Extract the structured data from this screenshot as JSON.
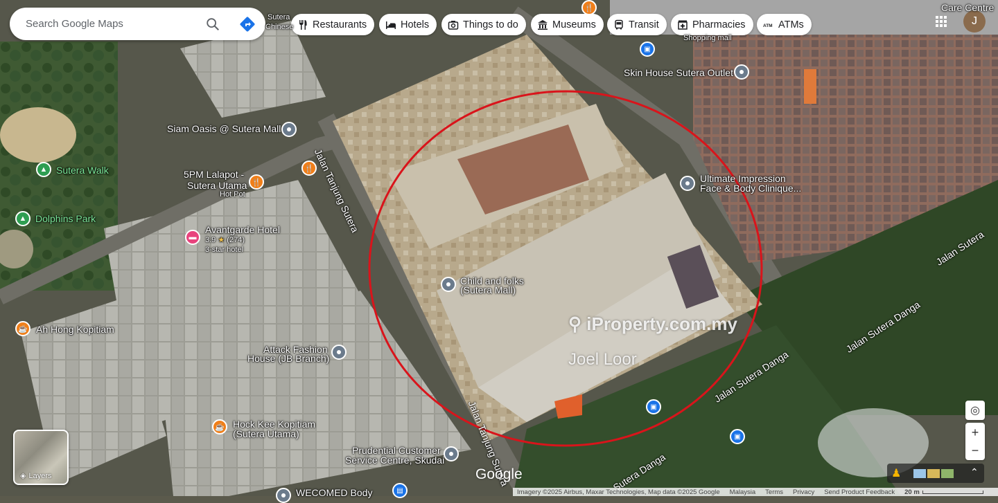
{
  "search": {
    "placeholder": "Search Google Maps"
  },
  "chips": [
    {
      "label": "Restaurants",
      "icon": "fork-knife-icon"
    },
    {
      "label": "Hotels",
      "icon": "bed-icon"
    },
    {
      "label": "Things to do",
      "icon": "camera-icon"
    },
    {
      "label": "Museums",
      "icon": "museum-icon"
    },
    {
      "label": "Transit",
      "icon": "bus-icon"
    },
    {
      "label": "Pharmacies",
      "icon": "pharmacy-icon"
    },
    {
      "label": "ATMs",
      "icon": "atm-icon"
    }
  ],
  "places": {
    "siam_oasis": "Siam Oasis @ Sutera Mall",
    "sutera_walk": "Sutera Walk",
    "lalapot_1": "5PM Lalapot -",
    "lalapot_2": "Sutera Utama",
    "lalapot_3": "Hot Pot",
    "dolphins_park": "Dolphins Park",
    "avantgarde": "Avantgarde Hotel",
    "avantgarde_rating": "3.9",
    "avantgarde_reviews": "(274)",
    "avantgarde_type": "3-star hotel",
    "ah_hong": "Ah Hong Kopitiam",
    "attack_1": "Attack Fashion",
    "attack_2": "House (JB Branch)",
    "hock_kee_1": "Hock Kee Kopitiam",
    "hock_kee_2": "(Sutera Utama)",
    "prudential_1": "Prudential Customer",
    "prudential_2": "Service Centre, Skudai",
    "wecomed": "WECOMED Body",
    "child_folks_1": "Child and folks",
    "child_folks_2": "(Sutera Mall)",
    "skin_house": "Skin House Sutera Outlet",
    "ultimate_1": "Ultimate Impression",
    "ultimate_2": "Face & Body Clinique...",
    "shopping_mall": "Shopping mall",
    "sutera_chinese_1": "Sutera",
    "sutera_chinese_2": "Chinese",
    "care_centre": "Care Centre"
  },
  "roads": {
    "tanjung_1": "Jalan Tanjung Sutera",
    "tanjung_2": "Jalan Tanjung Sutera",
    "danga_1": "Jalan Sutera Danga",
    "danga_2": "Jalan Sutera Danga",
    "danga_3": "Sutera Danga",
    "sutera_right": "Jalan Sutera"
  },
  "watermark": {
    "site": "iProperty.com.my",
    "agent": "Joel Loor"
  },
  "google_logo": "Google",
  "layers_label": "Layers",
  "avatar_letter": "J",
  "footer": {
    "attribution": "Imagery ©2025 Airbus, Maxar Technologies, Map data ©2025 Google",
    "country": "Malaysia",
    "terms": "Terms",
    "privacy": "Privacy",
    "feedback": "Send Product Feedback",
    "scale": "20 m"
  },
  "colors": {
    "circle": "#d9141b",
    "accent": "#1a73e8"
  }
}
